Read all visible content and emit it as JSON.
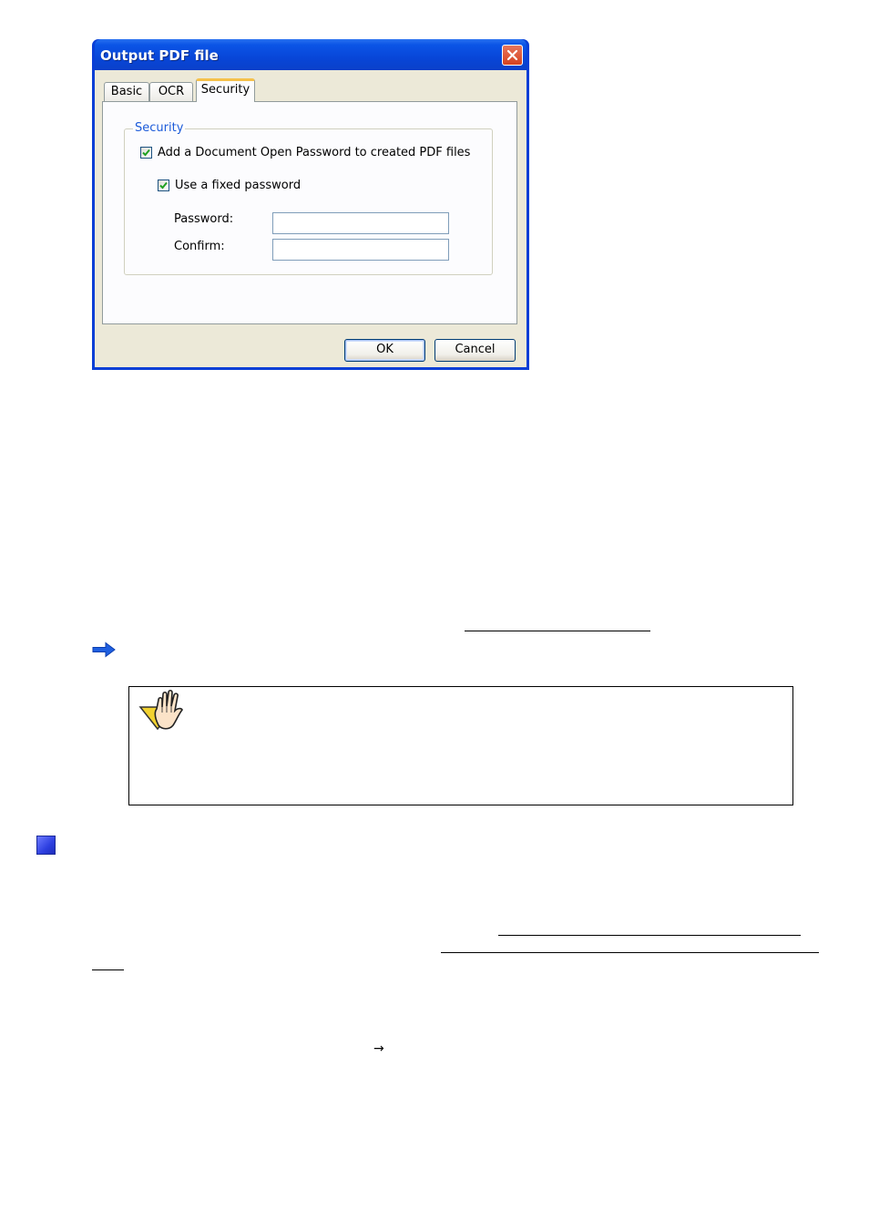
{
  "dialog": {
    "title": "Output PDF file",
    "close_icon": "close-x-icon",
    "tabs": [
      {
        "label": "Basic",
        "selected": false
      },
      {
        "label": "OCR",
        "selected": false
      },
      {
        "label": "Security",
        "selected": true
      }
    ],
    "security_group": {
      "legend": "Security",
      "add_password_checkbox": {
        "label": "Add a Document Open Password to created PDF files",
        "checked": true
      },
      "fixed_password_checkbox": {
        "label": "Use a fixed password",
        "checked": true
      },
      "password_label": "Password:",
      "password_value": "",
      "confirm_label": "Confirm:",
      "confirm_value": ""
    },
    "ok_label": "OK",
    "cancel_label": "Cancel"
  },
  "document": {
    "arrow_icon": "blue-right-arrow-icon",
    "caution_icon": "caution-hand-icon",
    "section_bullet_icon": "blue-square-bullet-icon",
    "right_arrow_glyph": "→"
  }
}
